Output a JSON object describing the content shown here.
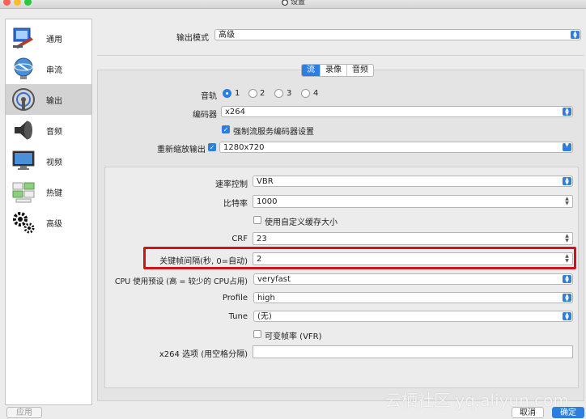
{
  "window": {
    "title": "设置"
  },
  "sidebar": {
    "items": [
      {
        "label": "通用",
        "icon": "general-icon"
      },
      {
        "label": "串流",
        "icon": "stream-icon"
      },
      {
        "label": "输出",
        "icon": "output-icon",
        "active": true
      },
      {
        "label": "音频",
        "icon": "speaker-icon"
      },
      {
        "label": "视频",
        "icon": "monitor-icon"
      },
      {
        "label": "热键",
        "icon": "keyboard-icon"
      },
      {
        "label": "高级",
        "icon": "gears-icon"
      }
    ]
  },
  "output_mode": {
    "label": "输出模式",
    "value": "高级"
  },
  "tabs": [
    {
      "label": "流",
      "active": true
    },
    {
      "label": "录像"
    },
    {
      "label": "音频"
    }
  ],
  "audio_track": {
    "label": "音轨",
    "options": [
      "1",
      "2",
      "3",
      "4"
    ],
    "selected": "1"
  },
  "encoder": {
    "label": "编码器",
    "value": "x264"
  },
  "enforce_encoder": {
    "label": "强制流服务编码器设置",
    "checked": true
  },
  "rescale": {
    "label": "重新缩放输出",
    "checked": true,
    "value": "1280x720"
  },
  "rate_control": {
    "label": "速率控制",
    "value": "VBR"
  },
  "bitrate": {
    "label": "比特率",
    "value": "1000"
  },
  "custom_buffer": {
    "label": "使用自定义缓存大小",
    "checked": false
  },
  "crf": {
    "label": "CRF",
    "value": "23"
  },
  "keyframe": {
    "label": "关键帧间隔(秒, 0=自动)",
    "value": "2"
  },
  "cpu_preset": {
    "label": "CPU 使用预设 (高 = 较少的 CPU占用)",
    "value": "veryfast"
  },
  "profile": {
    "label": "Profile",
    "value": "high"
  },
  "tune": {
    "label": "Tune",
    "value": "(无)"
  },
  "vfr": {
    "label": "可变帧率 (VFR)",
    "checked": false
  },
  "x264_options": {
    "label": "x264 选项 (用空格分隔)",
    "value": ""
  },
  "buttons": {
    "apply": "应用",
    "cancel": "取消",
    "ok": "确定"
  },
  "watermark": "云栖社区 yq.aliyun.com",
  "colors": {
    "accent": "#2c7fe0",
    "highlight": "#d0131a"
  }
}
